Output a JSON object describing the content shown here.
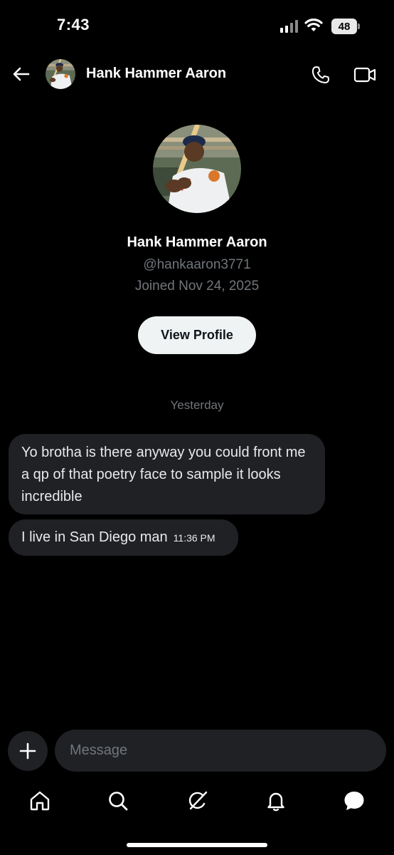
{
  "status_bar": {
    "time": "7:43",
    "battery": "48"
  },
  "header": {
    "name": "Hank Hammer Aaron"
  },
  "profile": {
    "name": "Hank Hammer Aaron",
    "handle": "@hankaaron3771",
    "joined": "Joined Nov 24, 2025",
    "view_profile_label": "View Profile"
  },
  "conversation": {
    "day_label": "Yesterday",
    "messages": [
      {
        "text": "Yo brotha is there anyway you could front me a qp of that poetry face to sample it looks incredible"
      },
      {
        "text": "I live in San Diego man",
        "time": "11:36 PM"
      }
    ]
  },
  "composer": {
    "placeholder": "Message"
  },
  "nav": {
    "items": [
      "home-icon",
      "search-icon",
      "grok-icon",
      "notifications-icon",
      "messages-icon"
    ]
  },
  "colors": {
    "background": "#000000",
    "bubble": "#1f2124",
    "muted_text": "#71767b",
    "button_bg": "#eff3f4"
  }
}
